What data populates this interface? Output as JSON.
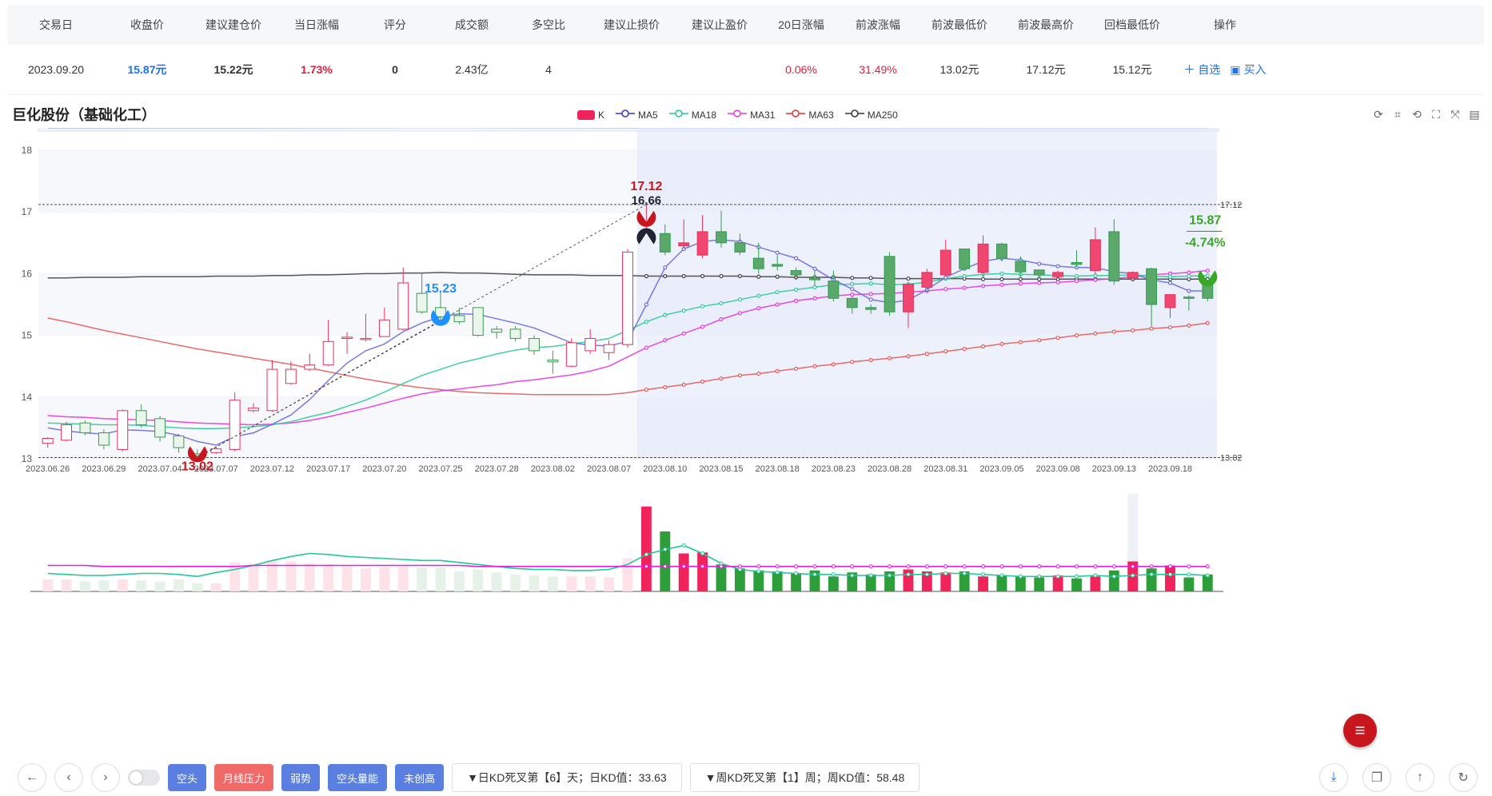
{
  "table": {
    "headers": [
      "交易日",
      "收盘价",
      "建议建仓价",
      "当日涨幅",
      "评分",
      "成交额",
      "多空比",
      "建议止损价",
      "建议止盈价",
      "20日涨幅",
      "前波涨幅",
      "前波最低价",
      "前波最高价",
      "回档最低价",
      "操作"
    ],
    "row": [
      "2023.09.20",
      "15.87元",
      "15.22元",
      "1.73%",
      "0",
      "2.43亿",
      "4",
      "",
      "",
      "0.06%",
      "31.49%",
      "13.02元",
      "17.12元",
      "15.12元"
    ],
    "op_add": "＋ 自选",
    "op_buy": "▣ 买入"
  },
  "stock_title": "巨化股份（基础化工）",
  "legend": [
    {
      "label": "K",
      "color": "#f0245a"
    },
    {
      "label": "MA5",
      "color": "#3333cc"
    },
    {
      "label": "MA18",
      "color": "#22c79a"
    },
    {
      "label": "MA31",
      "color": "#e836e0"
    },
    {
      "label": "MA63",
      "color": "#e03030"
    },
    {
      "label": "MA250",
      "color": "#333333"
    }
  ],
  "chart_data": {
    "type": "candlestick",
    "dates": [
      "2023.06.26",
      "2023.06.27",
      "2023.06.28",
      "2023.06.29",
      "2023.06.30",
      "2023.07.03",
      "2023.07.04",
      "2023.07.05",
      "2023.07.06",
      "2023.07.07",
      "2023.07.10",
      "2023.07.11",
      "2023.07.12",
      "2023.07.13",
      "2023.07.14",
      "2023.07.17",
      "2023.07.18",
      "2023.07.19",
      "2023.07.20",
      "2023.07.21",
      "2023.07.24",
      "2023.07.25",
      "2023.07.26",
      "2023.07.27",
      "2023.07.28",
      "2023.07.31",
      "2023.08.01",
      "2023.08.02",
      "2023.08.03",
      "2023.08.04",
      "2023.08.07",
      "2023.08.08",
      "2023.08.09",
      "2023.08.10",
      "2023.08.11",
      "2023.08.14",
      "2023.08.15",
      "2023.08.16",
      "2023.08.17",
      "2023.08.18",
      "2023.08.21",
      "2023.08.22",
      "2023.08.23",
      "2023.08.24",
      "2023.08.25",
      "2023.08.28",
      "2023.08.29",
      "2023.08.30",
      "2023.08.31",
      "2023.09.01",
      "2023.09.04",
      "2023.09.05",
      "2023.09.06",
      "2023.09.07",
      "2023.09.08",
      "2023.09.11",
      "2023.09.12",
      "2023.09.13",
      "2023.09.14",
      "2023.09.15",
      "2023.09.18",
      "2023.09.19",
      "2023.09.20"
    ],
    "x_ticks": [
      "2023.06.26",
      "2023.06.29",
      "2023.07.04",
      "2023.07.07",
      "2023.07.12",
      "2023.07.17",
      "2023.07.20",
      "2023.07.25",
      "2023.07.28",
      "2023.08.02",
      "2023.08.07",
      "2023.08.10",
      "2023.08.15",
      "2023.08.18",
      "2023.08.23",
      "2023.08.28",
      "2023.08.31",
      "2023.09.05",
      "2023.09.08",
      "2023.09.13",
      "2023.09.18"
    ],
    "ohlc": [
      [
        13.25,
        13.33,
        13.18,
        13.35
      ],
      [
        13.3,
        13.55,
        13.28,
        13.6
      ],
      [
        13.58,
        13.42,
        13.38,
        13.62
      ],
      [
        13.42,
        13.22,
        13.15,
        13.48
      ],
      [
        13.15,
        13.78,
        13.12,
        13.8
      ],
      [
        13.78,
        13.55,
        13.5,
        13.88
      ],
      [
        13.65,
        13.35,
        13.28,
        13.7
      ],
      [
        13.37,
        13.18,
        13.1,
        13.4
      ],
      [
        13.08,
        13.05,
        13.02,
        13.15
      ],
      [
        13.1,
        13.16,
        13.08,
        13.2
      ],
      [
        13.15,
        13.95,
        13.12,
        14.08
      ],
      [
        13.78,
        13.82,
        13.75,
        13.9
      ],
      [
        13.78,
        14.45,
        13.76,
        14.6
      ],
      [
        14.22,
        14.45,
        14.2,
        14.58
      ],
      [
        14.45,
        14.52,
        14.42,
        14.7
      ],
      [
        14.52,
        14.9,
        14.5,
        15.25
      ],
      [
        14.95,
        14.97,
        14.7,
        15.05
      ],
      [
        14.95,
        14.95,
        14.9,
        15.35
      ],
      [
        14.98,
        15.25,
        14.98,
        15.45
      ],
      [
        15.1,
        15.85,
        15.08,
        16.1
      ],
      [
        15.68,
        15.38,
        15.35,
        16.02
      ],
      [
        15.45,
        15.3,
        15.25,
        15.72
      ],
      [
        15.32,
        15.22,
        15.18,
        15.45
      ],
      [
        15.45,
        15.0,
        14.98,
        15.45
      ],
      [
        15.1,
        15.05,
        14.95,
        15.15
      ],
      [
        15.1,
        14.95,
        14.9,
        15.15
      ],
      [
        14.95,
        14.75,
        14.68,
        15.0
      ],
      [
        14.6,
        14.57,
        14.38,
        14.75
      ],
      [
        14.5,
        14.88,
        14.48,
        14.95
      ],
      [
        14.75,
        14.95,
        14.7,
        15.1
      ],
      [
        14.72,
        14.85,
        14.6,
        14.92
      ],
      [
        14.85,
        16.35,
        14.8,
        16.4
      ],
      [
        16.66,
        16.7,
        16.66,
        17.12
      ],
      [
        16.65,
        16.35,
        16.3,
        16.8
      ],
      [
        16.45,
        16.5,
        16.4,
        16.88
      ],
      [
        16.3,
        16.68,
        16.25,
        16.95
      ],
      [
        16.68,
        16.5,
        16.42,
        17.02
      ],
      [
        16.5,
        16.35,
        16.3,
        16.65
      ],
      [
        16.25,
        16.08,
        16.0,
        16.5
      ],
      [
        16.15,
        16.12,
        16.05,
        16.3
      ],
      [
        16.05,
        15.98,
        15.9,
        16.1
      ],
      [
        15.93,
        15.9,
        15.8,
        16.05
      ],
      [
        15.88,
        15.6,
        15.55,
        16.05
      ],
      [
        15.6,
        15.45,
        15.35,
        15.62
      ],
      [
        15.45,
        15.42,
        15.35,
        15.5
      ],
      [
        16.28,
        15.38,
        15.32,
        16.35
      ],
      [
        15.38,
        15.83,
        15.12,
        15.85
      ],
      [
        15.78,
        16.02,
        15.72,
        16.08
      ],
      [
        15.98,
        16.38,
        15.95,
        16.55
      ],
      [
        16.4,
        16.08,
        16.05,
        16.4
      ],
      [
        16.02,
        16.48,
        15.95,
        16.62
      ],
      [
        16.48,
        16.25,
        16.2,
        16.5
      ],
      [
        16.2,
        16.03,
        15.95,
        16.28
      ],
      [
        16.06,
        15.98,
        15.92,
        16.06
      ],
      [
        15.95,
        16.02,
        15.92,
        16.05
      ],
      [
        16.18,
        16.15,
        16.1,
        16.38
      ],
      [
        16.05,
        16.55,
        15.98,
        16.75
      ],
      [
        16.68,
        15.88,
        15.82,
        16.88
      ],
      [
        15.93,
        16.02,
        15.9,
        16.02
      ],
      [
        16.08,
        15.5,
        15.15,
        16.1
      ],
      [
        15.45,
        15.66,
        15.28,
        15.66
      ],
      [
        15.62,
        15.6,
        15.4,
        15.65
      ],
      [
        15.84,
        15.6,
        15.55,
        15.9
      ]
    ],
    "ma5": [
      13.5,
      13.45,
      13.42,
      13.4,
      13.47,
      13.46,
      13.44,
      13.38,
      13.28,
      13.22,
      13.36,
      13.42,
      13.56,
      13.71,
      13.96,
      14.27,
      14.55,
      14.75,
      14.86,
      15.06,
      15.2,
      15.3,
      15.35,
      15.34,
      15.27,
      15.2,
      15.12,
      15.0,
      14.88,
      14.84,
      14.83,
      14.9,
      15.5,
      16.1,
      16.4,
      16.52,
      16.55,
      16.52,
      16.43,
      16.34,
      16.25,
      16.08,
      15.9,
      15.75,
      15.58,
      15.53,
      15.57,
      15.74,
      15.94,
      16.08,
      16.2,
      16.25,
      16.22,
      16.16,
      16.12,
      16.1,
      16.1,
      16.03,
      16.0,
      15.9,
      15.85,
      15.72,
      15.72
    ],
    "ma18": [
      13.58,
      13.57,
      13.56,
      13.55,
      13.55,
      13.54,
      13.52,
      13.5,
      13.49,
      13.49,
      13.5,
      13.52,
      13.55,
      13.6,
      13.68,
      13.75,
      13.85,
      13.95,
      14.08,
      14.22,
      14.35,
      14.45,
      14.55,
      14.62,
      14.7,
      14.76,
      14.8,
      14.82,
      14.86,
      14.9,
      14.95,
      15.08,
      15.22,
      15.33,
      15.4,
      15.47,
      15.52,
      15.58,
      15.64,
      15.7,
      15.74,
      15.78,
      15.82,
      15.83,
      15.84,
      15.82,
      15.83,
      15.86,
      15.92,
      15.96,
      15.99,
      16.0,
      15.99,
      15.98,
      15.97,
      15.96,
      15.97,
      15.97,
      15.98,
      15.96,
      15.95,
      15.96,
      15.97
    ],
    "ma31": [
      13.7,
      13.68,
      13.67,
      13.65,
      13.64,
      13.63,
      13.62,
      13.6,
      13.58,
      13.57,
      13.56,
      13.55,
      13.56,
      13.58,
      13.62,
      13.68,
      13.75,
      13.82,
      13.9,
      13.98,
      14.05,
      14.1,
      14.13,
      14.17,
      14.2,
      14.25,
      14.28,
      14.32,
      14.36,
      14.42,
      14.5,
      14.65,
      14.8,
      14.92,
      15.03,
      15.14,
      15.26,
      15.36,
      15.44,
      15.5,
      15.56,
      15.6,
      15.64,
      15.66,
      15.67,
      15.68,
      15.7,
      15.72,
      15.75,
      15.77,
      15.8,
      15.82,
      15.84,
      15.85,
      15.86,
      15.88,
      15.9,
      15.92,
      15.95,
      15.98,
      16.0,
      16.02,
      16.05
    ],
    "ma63": [
      15.28,
      15.22,
      15.15,
      15.08,
      15.02,
      14.96,
      14.9,
      14.84,
      14.78,
      14.73,
      14.68,
      14.63,
      14.58,
      14.53,
      14.47,
      14.41,
      14.35,
      14.29,
      14.24,
      14.19,
      14.15,
      14.12,
      14.09,
      14.07,
      14.06,
      14.05,
      14.04,
      14.04,
      14.04,
      14.04,
      14.04,
      14.07,
      14.12,
      14.16,
      14.2,
      14.25,
      14.3,
      14.35,
      14.38,
      14.42,
      14.46,
      14.5,
      14.53,
      14.57,
      14.6,
      14.63,
      14.66,
      14.7,
      14.74,
      14.78,
      14.82,
      14.86,
      14.89,
      14.92,
      14.96,
      15.0,
      15.03,
      15.06,
      15.08,
      15.11,
      15.13,
      15.16,
      15.2
    ],
    "ma250": [
      15.93,
      15.93,
      15.94,
      15.94,
      15.94,
      15.95,
      15.95,
      15.95,
      15.95,
      15.96,
      15.96,
      15.96,
      15.97,
      15.97,
      15.98,
      15.98,
      15.99,
      16.0,
      16.0,
      16.01,
      16.01,
      16.02,
      16.01,
      16.01,
      16.0,
      15.99,
      15.98,
      15.98,
      15.98,
      15.97,
      15.97,
      15.97,
      15.96,
      15.96,
      15.96,
      15.96,
      15.96,
      15.96,
      15.95,
      15.95,
      15.94,
      15.94,
      15.94,
      15.93,
      15.93,
      15.92,
      15.92,
      15.92,
      15.92,
      15.92,
      15.91,
      15.91,
      15.91,
      15.91,
      15.91,
      15.91,
      15.91,
      15.91,
      15.91,
      15.91,
      15.91,
      15.91,
      15.91
    ],
    "volume": [
      12,
      12,
      10,
      11,
      12,
      11,
      10,
      12,
      8,
      8,
      29,
      28,
      31,
      30,
      28,
      27,
      25,
      23,
      24,
      25,
      24,
      24,
      20,
      22,
      19,
      17,
      16,
      15,
      15,
      15,
      14,
      33,
      85,
      60,
      38,
      39,
      27,
      23,
      21,
      20,
      18,
      21,
      15,
      19,
      17,
      20,
      22,
      20,
      19,
      20,
      15,
      16,
      15,
      14,
      16,
      13,
      15,
      21,
      30,
      23,
      26,
      14,
      17,
      17
    ],
    "vol_ma_green": [
      18,
      17,
      16,
      16,
      17,
      18,
      18,
      17,
      15,
      19,
      22,
      26,
      31,
      35,
      38,
      37,
      35,
      34,
      33,
      32,
      31,
      31,
      29,
      27,
      25,
      23,
      22,
      22,
      21,
      21,
      22,
      27,
      37,
      42,
      46,
      38,
      28,
      22,
      20,
      19,
      18,
      17,
      17,
      16,
      16,
      16,
      17,
      17,
      18,
      18,
      17,
      16,
      15,
      15,
      15,
      15,
      16,
      15,
      16,
      17,
      17,
      17,
      16
    ],
    "vol_ma_pink": [
      26,
      26,
      26,
      25,
      25,
      25,
      25,
      25,
      25,
      25,
      25,
      26,
      26,
      26,
      26,
      26,
      26,
      26,
      26,
      26,
      26,
      26,
      26,
      25,
      25,
      25,
      25,
      25,
      25,
      25,
      25,
      25,
      25,
      25,
      25,
      25,
      25,
      25,
      25,
      25,
      25,
      25,
      25,
      25,
      25,
      25,
      25,
      25,
      25,
      25,
      25,
      25,
      25,
      25,
      25,
      25,
      25,
      25,
      25,
      25,
      25,
      25,
      25
    ],
    "y_ticks": [
      "13",
      "14",
      "15",
      "16",
      "17",
      "18"
    ],
    "ylim": [
      13,
      18
    ],
    "ref_high": "17.12",
    "ref_low": "13.02",
    "markers": [
      {
        "label": "17.12",
        "idx": 32,
        "value": 17.12,
        "color": "#c7161e"
      },
      {
        "label": "16.66",
        "idx": 32,
        "value": 16.66,
        "color": "#1f2533"
      },
      {
        "label": "15.23",
        "idx": 21,
        "value": 15.23,
        "color": "#1e90ff"
      },
      {
        "label": "13.02",
        "idx": 8,
        "value": 13.02,
        "color": "#c7161e"
      }
    ],
    "last_price": "15.87",
    "last_change": "-4.74%"
  },
  "footer": {
    "tags": [
      {
        "label": "空头",
        "color": "#5b7fe0"
      },
      {
        "label": "月线压力",
        "color": "#f06a6a"
      },
      {
        "label": "弱势",
        "color": "#5b7fe0"
      },
      {
        "label": "空头量能",
        "color": "#5b7fe0"
      },
      {
        "label": "未创高",
        "color": "#5b7fe0"
      }
    ],
    "kd_day": "▼日KD死叉第【6】天；日KD值：33.63",
    "kd_week": "▼周KD死叉第【1】周；周KD值：58.48"
  }
}
